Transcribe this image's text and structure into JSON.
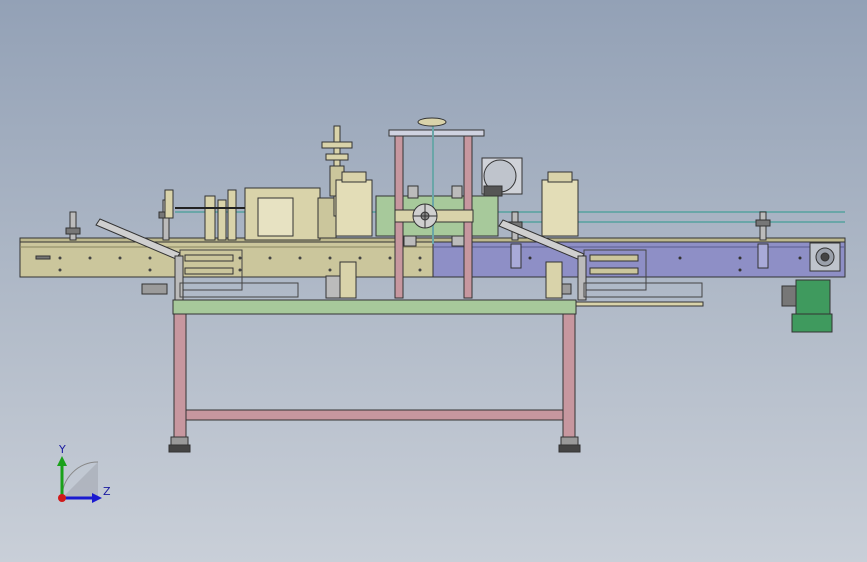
{
  "viewport": {
    "background_top": "#93a1b6",
    "background_bottom": "#c9cfd8"
  },
  "colors": {
    "tan_frame": "#cbc69c",
    "purple_conveyor": "#8e8fc6",
    "pink_frame": "#c7979f",
    "green_plate": "#a7c99b",
    "green_motor": "#3f9a5e",
    "outline": "#333333"
  },
  "triad": {
    "y_label": "Y",
    "z_label": "Z",
    "y_color": "#1aa11a",
    "z_color": "#1a1ad0",
    "x_color": "#d01a1a"
  }
}
